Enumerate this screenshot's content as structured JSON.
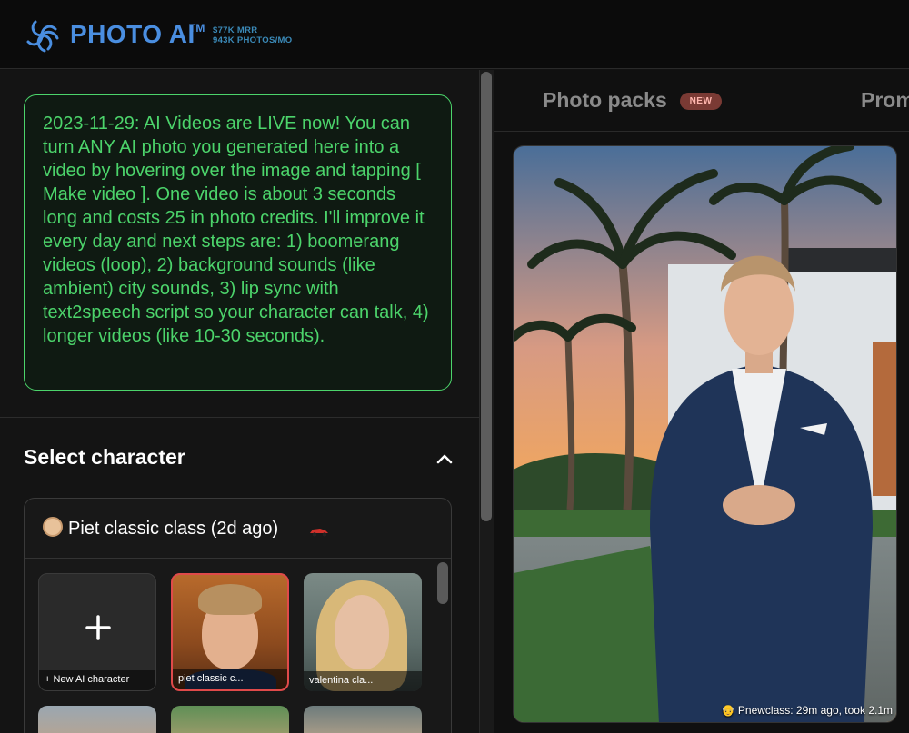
{
  "header": {
    "brand": "PHOTO AI",
    "trademark": "TM",
    "mrr": "$77K MRR",
    "photos": "943K PHOTOS/MO"
  },
  "announcement": {
    "text": "2023-11-29: AI Videos are LIVE now! You can turn ANY AI photo you generated here into a video by hovering over the image and tapping [ Make video ]. One video is about 3 seconds long and costs 25 in photo credits. I'll improve it every day and next steps are: 1) boomerang videos (loop), 2) background sounds (like ambient) city sounds, 3) lip sync with text2speech script so your character can talk, 4) longer videos (like 10-30 seconds)."
  },
  "select_character": {
    "title": "Select character",
    "current": "Piet classic class (2d ago)",
    "tiles": [
      {
        "label": "New AI character"
      },
      {
        "label": "piet classic c..."
      },
      {
        "label": "valentina cla..."
      }
    ]
  },
  "tabs": {
    "photo_packs": "Photo packs",
    "new_badge": "NEW",
    "prompts": "Prom"
  },
  "photo": {
    "caption": "Pnewclass: 29m ago, took 2.1m"
  },
  "colors": {
    "accent_green": "#4cd46b",
    "brand_blue": "#4a8ee0",
    "badge_red": "#7a3a34"
  }
}
